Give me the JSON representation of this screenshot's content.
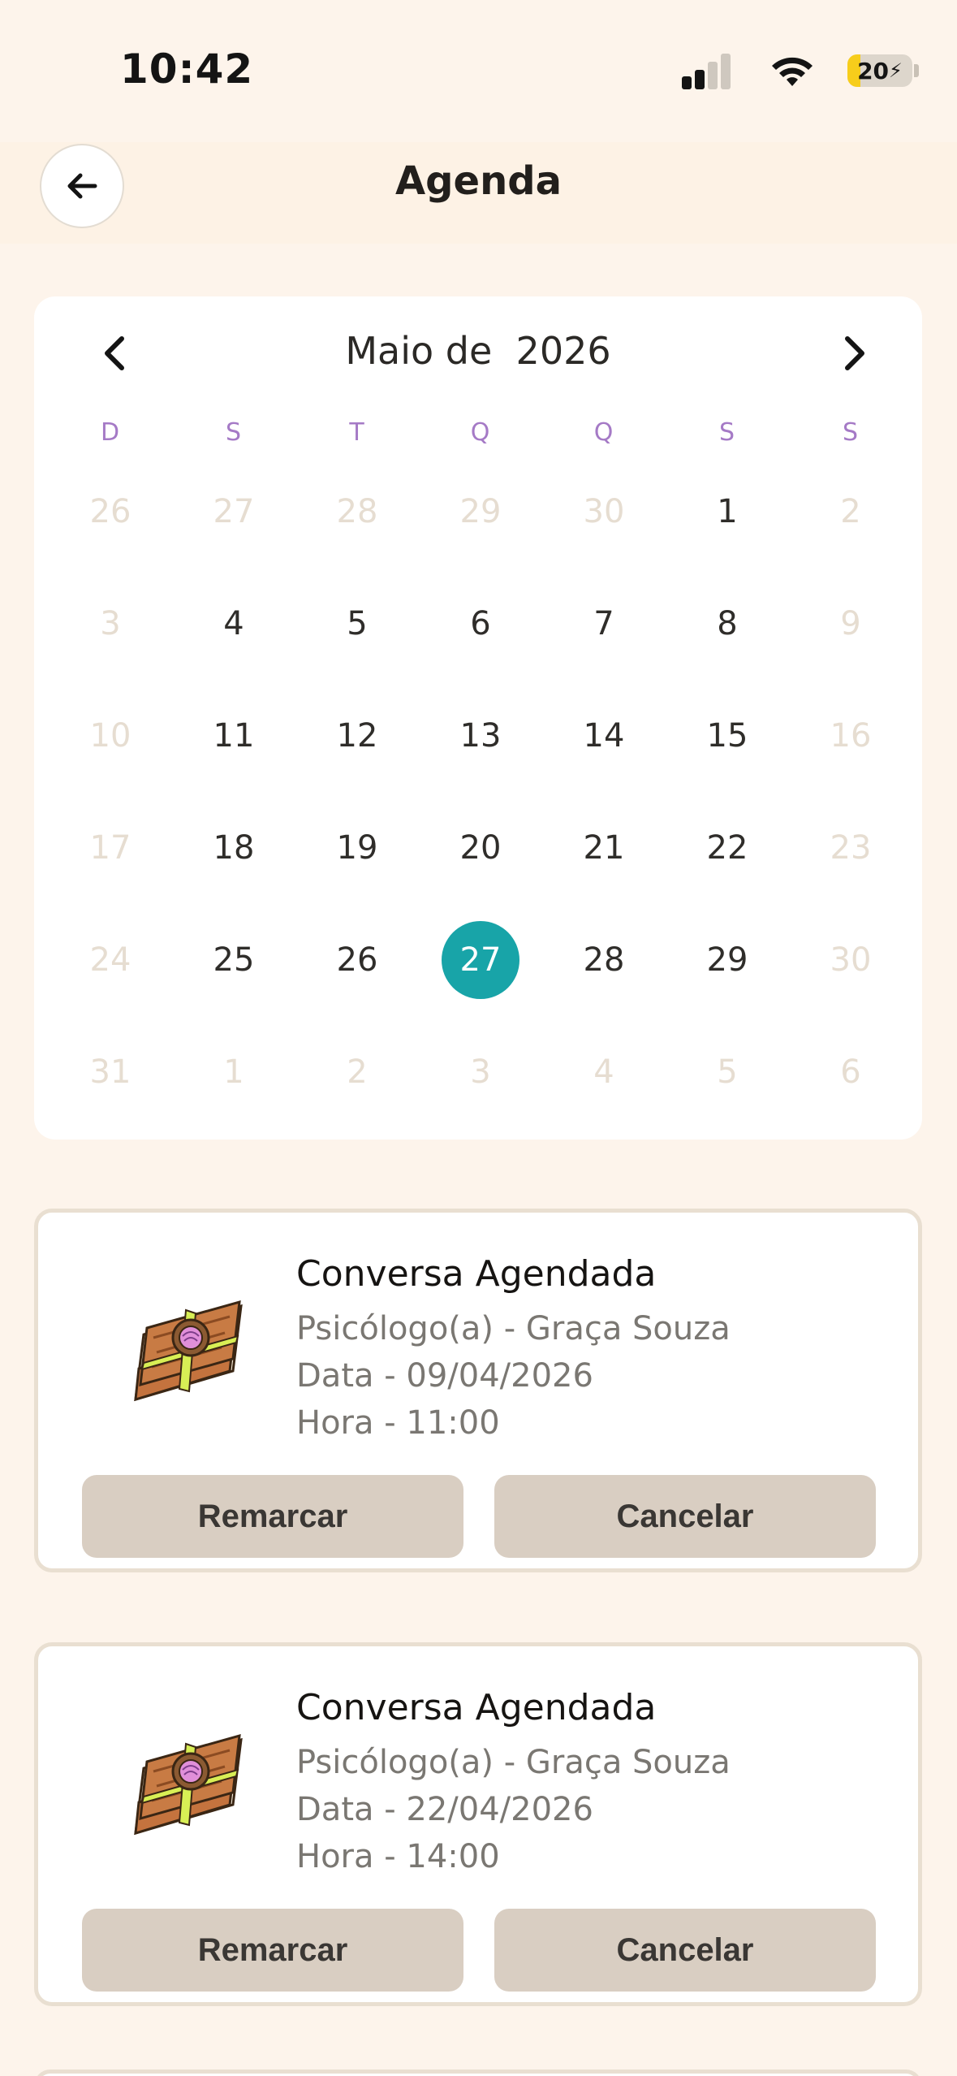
{
  "status": {
    "time": "10:42",
    "battery": "20",
    "battery_level": 0.2
  },
  "header": {
    "title": "Agenda",
    "back_icon": "arrow-left-icon"
  },
  "calendar": {
    "month": "Maio de",
    "year": "2026",
    "weekdays": [
      "D",
      "S",
      "T",
      "Q",
      "Q",
      "S",
      "S"
    ],
    "days": [
      {
        "label": "26",
        "muted": true
      },
      {
        "label": "27",
        "muted": true
      },
      {
        "label": "28",
        "muted": true
      },
      {
        "label": "29",
        "muted": true
      },
      {
        "label": "30",
        "muted": true
      },
      {
        "label": "1",
        "muted": false
      },
      {
        "label": "2",
        "muted": true
      },
      {
        "label": "3",
        "muted": true
      },
      {
        "label": "4",
        "muted": false
      },
      {
        "label": "5",
        "muted": false
      },
      {
        "label": "6",
        "muted": false
      },
      {
        "label": "7",
        "muted": false
      },
      {
        "label": "8",
        "muted": false
      },
      {
        "label": "9",
        "muted": true
      },
      {
        "label": "10",
        "muted": true
      },
      {
        "label": "11",
        "muted": false
      },
      {
        "label": "12",
        "muted": false
      },
      {
        "label": "13",
        "muted": false
      },
      {
        "label": "14",
        "muted": false
      },
      {
        "label": "15",
        "muted": false
      },
      {
        "label": "16",
        "muted": true
      },
      {
        "label": "17",
        "muted": true
      },
      {
        "label": "18",
        "muted": false
      },
      {
        "label": "19",
        "muted": false
      },
      {
        "label": "20",
        "muted": false
      },
      {
        "label": "21",
        "muted": false
      },
      {
        "label": "22",
        "muted": false
      },
      {
        "label": "23",
        "muted": true
      },
      {
        "label": "24",
        "muted": true
      },
      {
        "label": "25",
        "muted": false
      },
      {
        "label": "26",
        "muted": false
      },
      {
        "label": "27",
        "muted": false,
        "selected": true
      },
      {
        "label": "28",
        "muted": false
      },
      {
        "label": "29",
        "muted": false
      },
      {
        "label": "30",
        "muted": true
      },
      {
        "label": "31",
        "muted": true
      },
      {
        "label": "1",
        "muted": true
      },
      {
        "label": "2",
        "muted": true
      },
      {
        "label": "3",
        "muted": true
      },
      {
        "label": "4",
        "muted": true
      },
      {
        "label": "5",
        "muted": true
      },
      {
        "label": "6",
        "muted": true
      }
    ]
  },
  "appointments": [
    {
      "title": "Conversa Agendada",
      "professional": "Psicólogo(a) - Graça Souza",
      "date": "Data - 09/04/2026",
      "time": "Hora - 11:00",
      "reschedule_label": "Remarcar",
      "cancel_label": "Cancelar",
      "icon": "book-brain-icon"
    },
    {
      "title": "Conversa Agendada",
      "professional": "Psicólogo(a) - Graça Souza",
      "date": "Data - 22/04/2026",
      "time": "Hora - 14:00",
      "reschedule_label": "Remarcar",
      "cancel_label": "Cancelar",
      "icon": "book-brain-icon"
    }
  ],
  "colors": {
    "background": "#fdf4eb",
    "accent": "#18a4a8",
    "weekday": "#a57ac6",
    "button": "#d9cec2"
  }
}
